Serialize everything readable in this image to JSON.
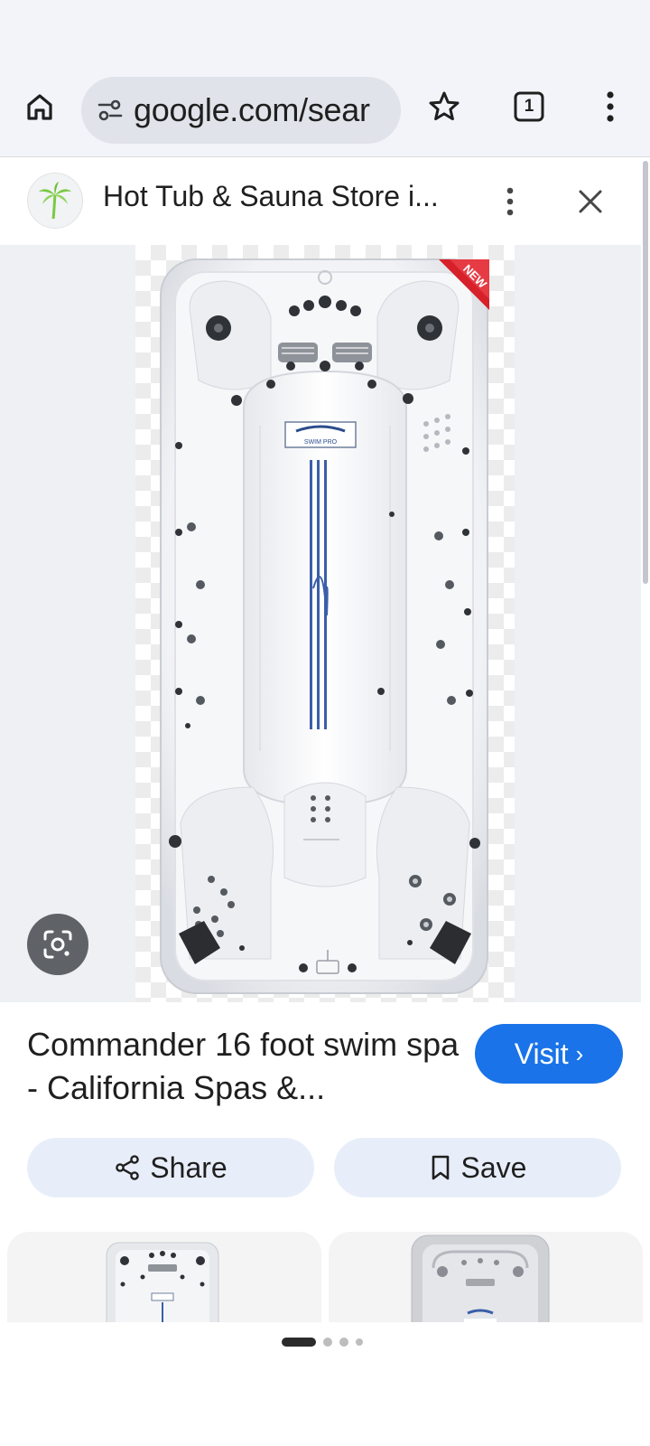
{
  "browser": {
    "url": "google.com/sear",
    "tab_count": "1",
    "icons": [
      "home-icon",
      "site-info-icon",
      "star-icon",
      "tab-switcher-icon",
      "more-vert-icon"
    ]
  },
  "panel": {
    "title": "Hot Tub & Sauna Store i...",
    "icons": [
      "site-logo-icon",
      "more-vert-icon",
      "close-icon"
    ]
  },
  "image": {
    "badge": "NEW",
    "logo_text": "SWIM PRO",
    "lens_icon": "google-lens-icon"
  },
  "result": {
    "title": "Commander 16 foot swim spa - California Spas &...",
    "visit_label": "Visit",
    "visit_chevron": "›",
    "share_label": "Share",
    "save_label": "Save"
  },
  "pager": {
    "total": 4,
    "active_index": 0
  },
  "colors": {
    "accent": "#1a73e8",
    "pill_bg": "#e8eef9",
    "badge_red": "#d6202a",
    "stripe_blue": "#3b5ea8"
  }
}
